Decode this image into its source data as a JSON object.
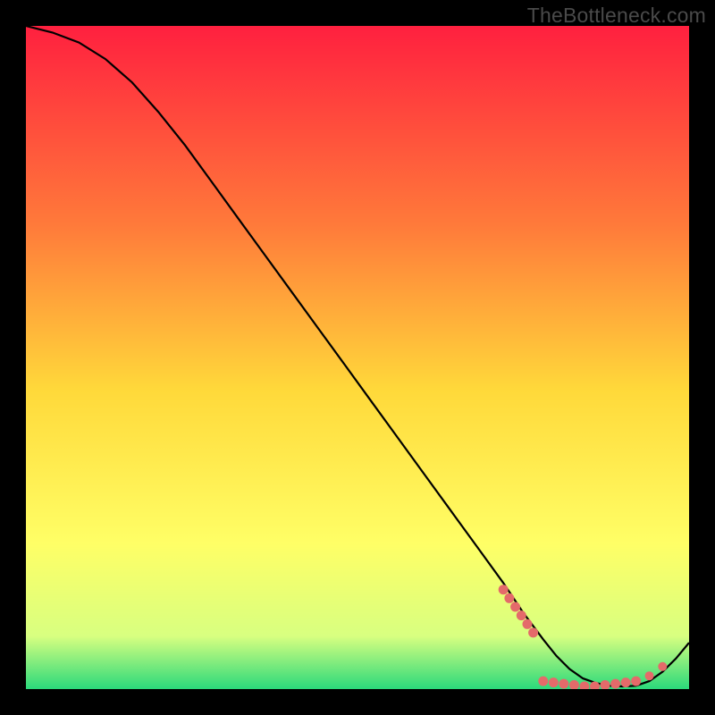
{
  "watermark": "TheBottleneck.com",
  "colors": {
    "bg": "#000000",
    "gradient_top": "#ff203f",
    "gradient_mid1": "#ff7a3a",
    "gradient_mid2": "#ffd93a",
    "gradient_mid3": "#ffff66",
    "gradient_mid4": "#d8ff80",
    "gradient_bottom": "#2bd97b",
    "curve": "#000000",
    "marker": "#e46a6a"
  },
  "chart_data": {
    "type": "line",
    "title": "",
    "xlabel": "",
    "ylabel": "",
    "xlim": [
      0,
      100
    ],
    "ylim": [
      0,
      100
    ],
    "grid": false,
    "series": [
      {
        "name": "bottleneck-curve",
        "x": [
          0,
          4,
          8,
          12,
          16,
          20,
          24,
          28,
          32,
          36,
          40,
          44,
          48,
          52,
          56,
          60,
          64,
          68,
          72,
          75,
          78,
          80,
          82,
          84,
          86,
          88,
          90,
          92,
          94,
          96,
          98,
          100
        ],
        "y": [
          100,
          99,
          97.5,
          95,
          91.5,
          87,
          82,
          76.5,
          71,
          65.5,
          60,
          54.5,
          49,
          43.5,
          38,
          32.5,
          27,
          21.5,
          16,
          11.5,
          7.5,
          5,
          3,
          1.6,
          0.9,
          0.5,
          0.4,
          0.5,
          1.2,
          2.6,
          4.6,
          7.0
        ]
      }
    ],
    "markers": {
      "cluster_a": {
        "x_range": [
          72,
          76.5
        ],
        "y_range": [
          8.5,
          15
        ],
        "count_approx": 6
      },
      "cluster_b": {
        "x_range": [
          78,
          92
        ],
        "y_range": [
          0.3,
          1.2
        ],
        "count_approx": 10
      },
      "outlier_1": {
        "x": 94,
        "y": 2.0
      },
      "outlier_2": {
        "x": 96,
        "y": 3.4
      }
    }
  }
}
